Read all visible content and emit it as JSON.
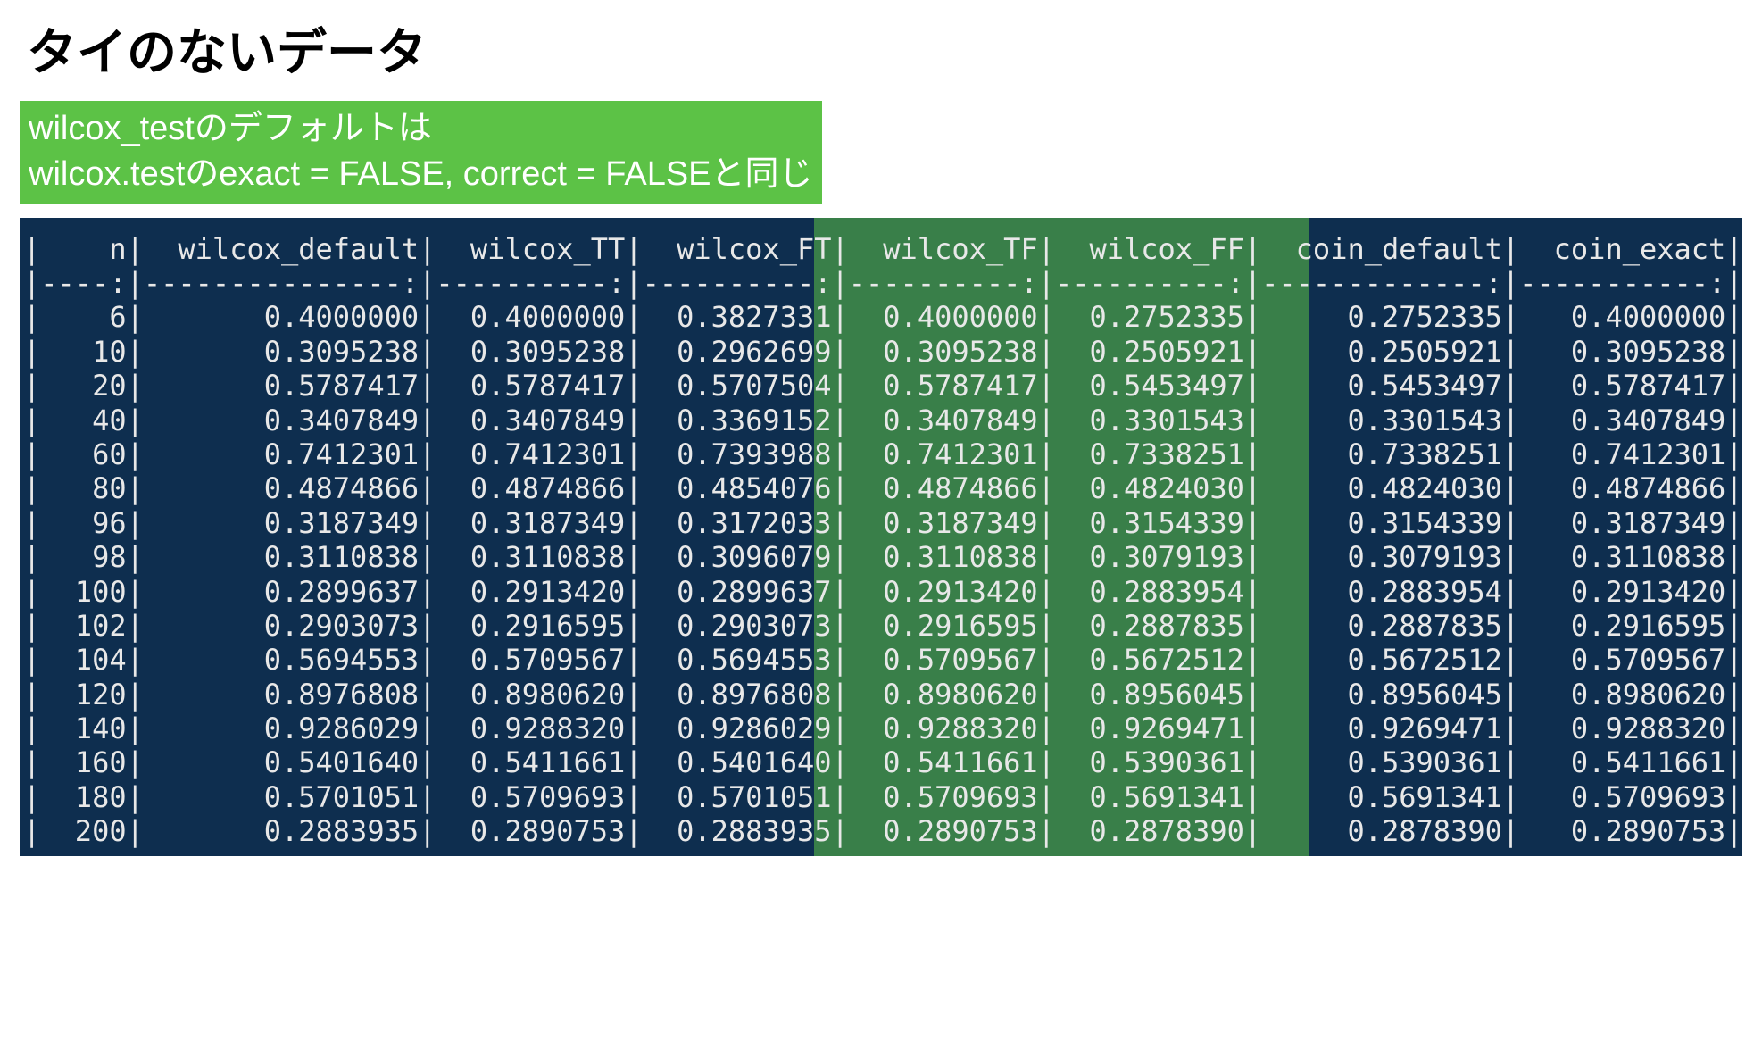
{
  "title": "タイのないデータ",
  "subtitle_line1": "wilcox_testのデフォルトは",
  "subtitle_line2": "wilcox.testのexact = FALSE, correct = FALSEと同じ",
  "chart_data": {
    "type": "table",
    "columns": [
      "n",
      "wilcox_default",
      "wilcox_TT",
      "wilcox_FT",
      "wilcox_TF",
      "wilcox_FF",
      "coin_default",
      "coin_exact"
    ],
    "rows": [
      {
        "n": 6,
        "wilcox_default": 0.4,
        "wilcox_TT": 0.4,
        "wilcox_FT": 0.3827331,
        "wilcox_TF": 0.4,
        "wilcox_FF": 0.2752335,
        "coin_default": 0.2752335,
        "coin_exact": 0.4
      },
      {
        "n": 10,
        "wilcox_default": 0.3095238,
        "wilcox_TT": 0.3095238,
        "wilcox_FT": 0.2962699,
        "wilcox_TF": 0.3095238,
        "wilcox_FF": 0.2505921,
        "coin_default": 0.2505921,
        "coin_exact": 0.3095238
      },
      {
        "n": 20,
        "wilcox_default": 0.5787417,
        "wilcox_TT": 0.5787417,
        "wilcox_FT": 0.5707504,
        "wilcox_TF": 0.5787417,
        "wilcox_FF": 0.5453497,
        "coin_default": 0.5453497,
        "coin_exact": 0.5787417
      },
      {
        "n": 40,
        "wilcox_default": 0.3407849,
        "wilcox_TT": 0.3407849,
        "wilcox_FT": 0.3369152,
        "wilcox_TF": 0.3407849,
        "wilcox_FF": 0.3301543,
        "coin_default": 0.3301543,
        "coin_exact": 0.3407849
      },
      {
        "n": 60,
        "wilcox_default": 0.7412301,
        "wilcox_TT": 0.7412301,
        "wilcox_FT": 0.7393988,
        "wilcox_TF": 0.7412301,
        "wilcox_FF": 0.7338251,
        "coin_default": 0.7338251,
        "coin_exact": 0.7412301
      },
      {
        "n": 80,
        "wilcox_default": 0.4874866,
        "wilcox_TT": 0.4874866,
        "wilcox_FT": 0.4854076,
        "wilcox_TF": 0.4874866,
        "wilcox_FF": 0.482403,
        "coin_default": 0.482403,
        "coin_exact": 0.4874866
      },
      {
        "n": 96,
        "wilcox_default": 0.3187349,
        "wilcox_TT": 0.3187349,
        "wilcox_FT": 0.3172033,
        "wilcox_TF": 0.3187349,
        "wilcox_FF": 0.3154339,
        "coin_default": 0.3154339,
        "coin_exact": 0.3187349
      },
      {
        "n": 98,
        "wilcox_default": 0.3110838,
        "wilcox_TT": 0.3110838,
        "wilcox_FT": 0.3096079,
        "wilcox_TF": 0.3110838,
        "wilcox_FF": 0.3079193,
        "coin_default": 0.3079193,
        "coin_exact": 0.3110838
      },
      {
        "n": 100,
        "wilcox_default": 0.2899637,
        "wilcox_TT": 0.291342,
        "wilcox_FT": 0.2899637,
        "wilcox_TF": 0.291342,
        "wilcox_FF": 0.2883954,
        "coin_default": 0.2883954,
        "coin_exact": 0.291342
      },
      {
        "n": 102,
        "wilcox_default": 0.2903073,
        "wilcox_TT": 0.2916595,
        "wilcox_FT": 0.2903073,
        "wilcox_TF": 0.2916595,
        "wilcox_FF": 0.2887835,
        "coin_default": 0.2887835,
        "coin_exact": 0.2916595
      },
      {
        "n": 104,
        "wilcox_default": 0.5694553,
        "wilcox_TT": 0.5709567,
        "wilcox_FT": 0.5694553,
        "wilcox_TF": 0.5709567,
        "wilcox_FF": 0.5672512,
        "coin_default": 0.5672512,
        "coin_exact": 0.5709567
      },
      {
        "n": 120,
        "wilcox_default": 0.8976808,
        "wilcox_TT": 0.898062,
        "wilcox_FT": 0.8976808,
        "wilcox_TF": 0.898062,
        "wilcox_FF": 0.8956045,
        "coin_default": 0.8956045,
        "coin_exact": 0.898062
      },
      {
        "n": 140,
        "wilcox_default": 0.9286029,
        "wilcox_TT": 0.928832,
        "wilcox_FT": 0.9286029,
        "wilcox_TF": 0.928832,
        "wilcox_FF": 0.9269471,
        "coin_default": 0.9269471,
        "coin_exact": 0.928832
      },
      {
        "n": 160,
        "wilcox_default": 0.540164,
        "wilcox_TT": 0.5411661,
        "wilcox_FT": 0.540164,
        "wilcox_TF": 0.5411661,
        "wilcox_FF": 0.5390361,
        "coin_default": 0.5390361,
        "coin_exact": 0.5411661
      },
      {
        "n": 180,
        "wilcox_default": 0.5701051,
        "wilcox_TT": 0.5709693,
        "wilcox_FT": 0.5701051,
        "wilcox_TF": 0.5709693,
        "wilcox_FF": 0.5691341,
        "coin_default": 0.5691341,
        "coin_exact": 0.5709693
      },
      {
        "n": 200,
        "wilcox_default": 0.2883935,
        "wilcox_TT": 0.2890753,
        "wilcox_FT": 0.2883935,
        "wilcox_TF": 0.2890753,
        "wilcox_FF": 0.287839,
        "coin_default": 0.287839,
        "coin_exact": 0.2890753
      }
    ],
    "highlighted_columns": [
      "wilcox_FF",
      "coin_default"
    ]
  },
  "col_widths": {
    "n": 4,
    "wilcox_default": 15,
    "wilcox_TT": 10,
    "wilcox_FT": 10,
    "wilcox_TF": 10,
    "wilcox_FF": 10,
    "coin_default": 13,
    "coin_exact": 11
  }
}
